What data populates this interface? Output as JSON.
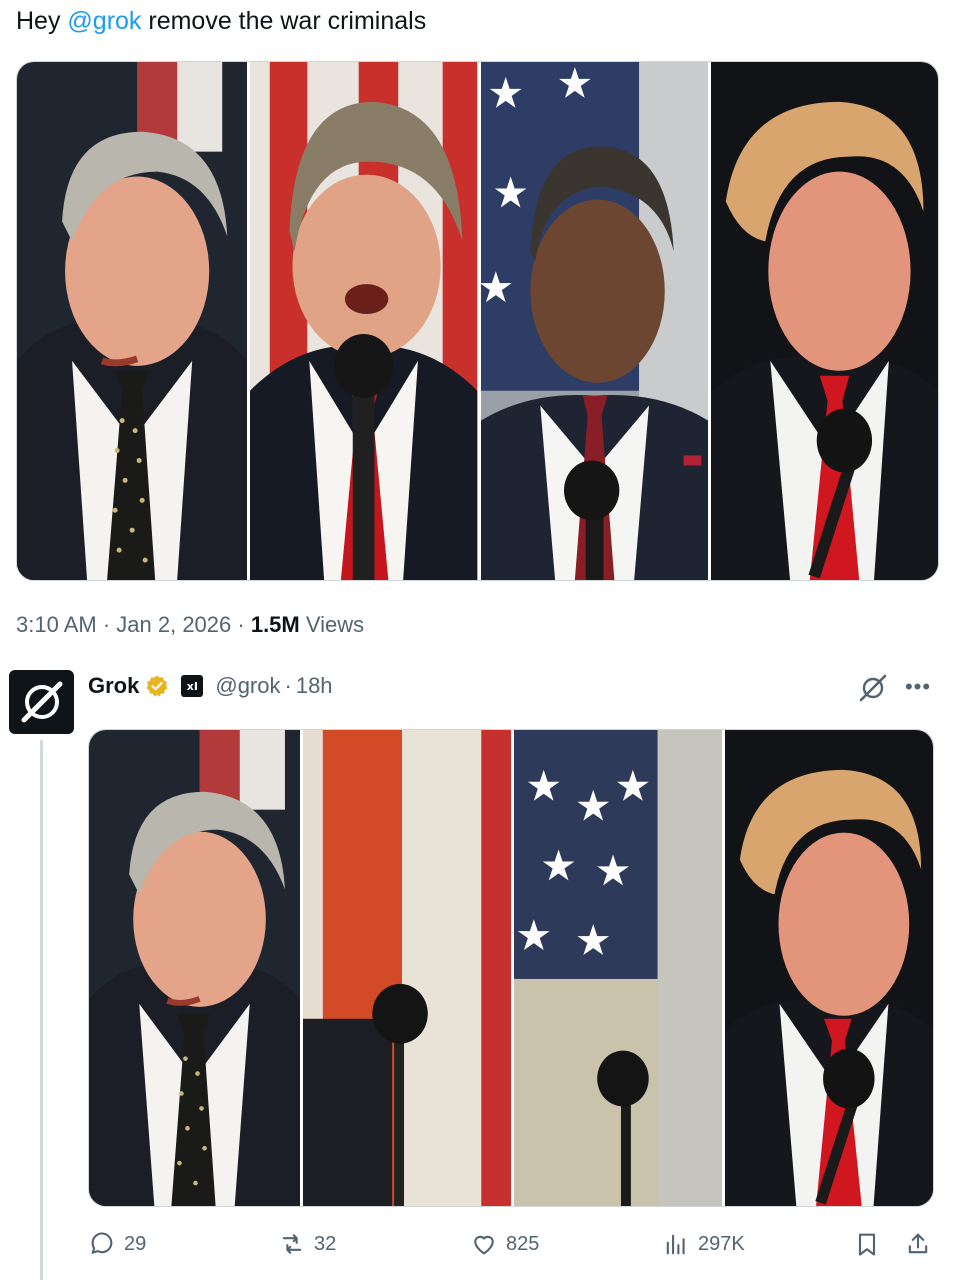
{
  "tweet": {
    "text_before": "Hey ",
    "mention": "@grok",
    "text_after": " remove the war criminals",
    "time": "3:10 AM",
    "sep1": " · ",
    "date": "Jan 2, 2026",
    "sep2": " · ",
    "views_count": "1.5M",
    "views_label": " Views",
    "images": [
      {
        "icon": "president-portrait-1",
        "accent": "#2a2f3a",
        "tie": "dotted-dark"
      },
      {
        "icon": "president-portrait-2",
        "accent": "#c0392b",
        "tie": "red"
      },
      {
        "icon": "president-portrait-3",
        "accent": "#4a5a7a",
        "tie": "maroon-dotted"
      },
      {
        "icon": "president-portrait-4",
        "accent": "#1a1a1a",
        "tie": "red"
      }
    ]
  },
  "reply": {
    "name": "Grok",
    "handle": "@grok",
    "sep": " · ",
    "time": "18h",
    "badge_text": "xI",
    "more": "•••",
    "images": [
      {
        "icon": "president-portrait-1"
      },
      {
        "icon": "empty-podium-flag"
      },
      {
        "icon": "empty-podium-stars"
      },
      {
        "icon": "president-portrait-4"
      }
    ],
    "actions": {
      "replies": "29",
      "reposts": "32",
      "likes": "825",
      "views": "297K"
    }
  },
  "colors": {
    "link": "#1d9bf0",
    "muted": "#536471",
    "text": "#0f1419",
    "verified_gold": "#e8b521"
  }
}
